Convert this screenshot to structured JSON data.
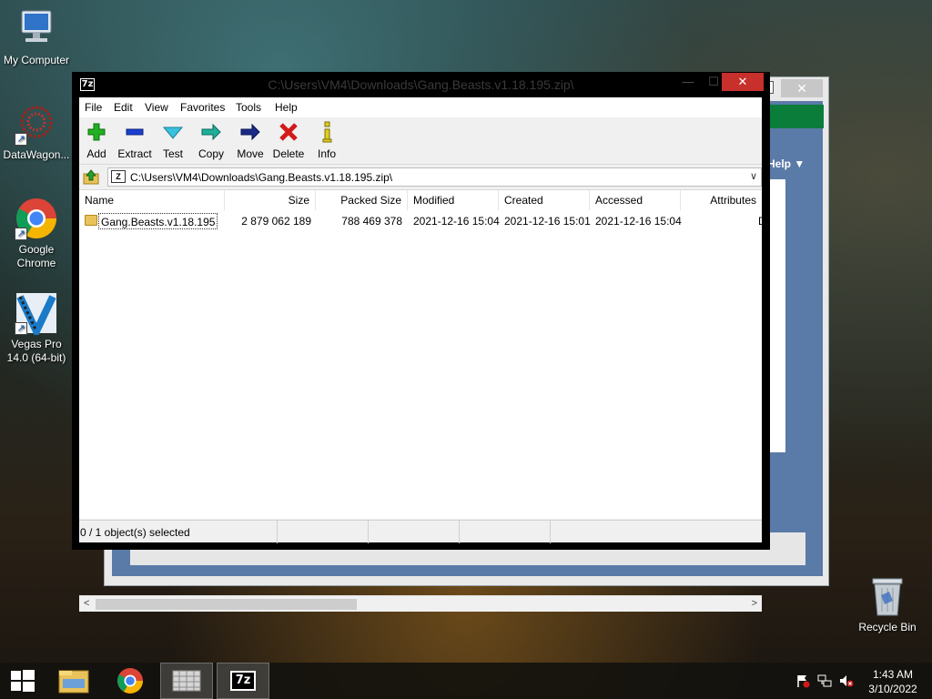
{
  "desktop": {
    "icons": [
      {
        "label": "My Computer",
        "icon": "computer-icon"
      },
      {
        "label": "DataWagon...",
        "icon": "datawagon-icon"
      },
      {
        "label": "Google Chrome",
        "icon": "chrome-icon"
      },
      {
        "label": "Vegas Pro 14.0 (64-bit)",
        "icon": "vegas-icon"
      },
      {
        "label": "Recycle Bin",
        "icon": "recycle-bin-icon"
      }
    ]
  },
  "background_window": {
    "help_label": "Help ▼"
  },
  "window": {
    "title": "C:\\Users\\VM4\\Downloads\\Gang.Beasts.v1.18.195.zip\\",
    "app_icon_label": "7z",
    "controls": {
      "minimize": "—",
      "maximize": "☐",
      "close": "✕"
    },
    "menu": [
      "File",
      "Edit",
      "View",
      "Favorites",
      "Tools",
      "Help"
    ],
    "toolbar": [
      {
        "label": "Add",
        "icon": "add-icon",
        "color": "#1aa31a"
      },
      {
        "label": "Extract",
        "icon": "extract-icon",
        "color": "#1a3fd1"
      },
      {
        "label": "Test",
        "icon": "test-icon",
        "color": "#2aa7c6"
      },
      {
        "label": "Copy",
        "icon": "copy-icon",
        "color": "#1a9a8a"
      },
      {
        "label": "Move",
        "icon": "move-icon",
        "color": "#1a2a8a"
      },
      {
        "label": "Delete",
        "icon": "delete-icon",
        "color": "#d31a1a"
      },
      {
        "label": "Info",
        "icon": "info-icon",
        "color": "#d9c21a"
      }
    ],
    "address": {
      "path": "C:\\Users\\VM4\\Downloads\\Gang.Beasts.v1.18.195.zip\\",
      "dropdown_glyph": "∨"
    },
    "columns": [
      "Name",
      "Size",
      "Packed Size",
      "Modified",
      "Created",
      "Accessed",
      "Attributes"
    ],
    "rows": [
      {
        "name": "Gang.Beasts.v1.18.195",
        "size": "2 879 062 189",
        "packed_size": "788 469 378",
        "modified": "2021-12-16 15:04",
        "created": "2021-12-16 15:01",
        "accessed": "2021-12-16 15:04",
        "attributes": "D"
      }
    ],
    "scroll": {
      "left": "<",
      "right": ">"
    },
    "status": "0 / 1 object(s) selected"
  },
  "taskbar": {
    "items": [
      {
        "name": "start-button",
        "icon": "windows-logo-icon"
      },
      {
        "name": "file-explorer",
        "icon": "folder-icon"
      },
      {
        "name": "chrome",
        "icon": "chrome-icon"
      },
      {
        "name": "app-window",
        "icon": "window-thumb-icon"
      },
      {
        "name": "7zip",
        "icon": "7zip-icon",
        "label": "7z"
      }
    ],
    "clock": {
      "time": "1:43 AM",
      "date": "3/10/2022"
    }
  }
}
